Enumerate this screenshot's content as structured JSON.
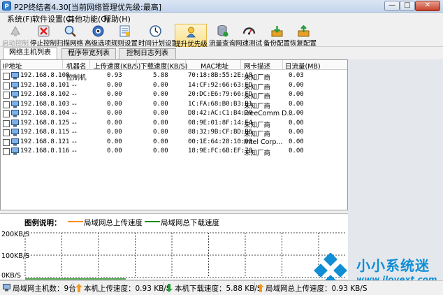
{
  "window": {
    "title": "P2P终结者4.30[当前网络管理优先级:最高]",
    "minimize": "—",
    "maximize": "□",
    "close": "✕"
  },
  "menu": [
    "系统(F)",
    "软件设置(C)",
    "其他功能(O)",
    "帮助(H)"
  ],
  "toolbar": [
    {
      "label": "启动控制",
      "icon": "start-control-icon",
      "enabled": false
    },
    {
      "label": "停止控制",
      "icon": "stop-control-icon",
      "enabled": true
    },
    {
      "label": "扫描网络",
      "icon": "scan-network-icon",
      "enabled": true
    },
    {
      "label": "高级选项",
      "icon": "advanced-options-icon",
      "enabled": true
    },
    {
      "label": "规则设置",
      "icon": "rule-settings-icon",
      "enabled": true
    },
    {
      "label": "时间计划设置",
      "icon": "time-plan-icon",
      "enabled": true
    },
    {
      "label": "提升优先级",
      "icon": "raise-priority-icon",
      "enabled": true,
      "active": true
    },
    {
      "label": "流量查询",
      "icon": "traffic-query-icon",
      "enabled": true
    },
    {
      "label": "网速测试",
      "icon": "speed-test-icon",
      "enabled": true
    },
    {
      "label": "备份配置",
      "icon": "backup-config-icon",
      "enabled": true
    },
    {
      "label": "恢复配置",
      "icon": "restore-config-icon",
      "enabled": true
    }
  ],
  "tabs": [
    {
      "label": "网络主机列表",
      "selected": true
    },
    {
      "label": "程序带宽列表",
      "selected": false
    },
    {
      "label": "控制日志列表",
      "selected": false
    }
  ],
  "table": {
    "columns": [
      "IP地址",
      "机器名",
      "上传速度(KB/S)",
      "下载速度(KB/S)",
      "MAC地址",
      "网卡描述",
      "日流量(MB)"
    ],
    "rows": [
      [
        "192.168.8.108",
        "控制机",
        "0.93",
        "5.88",
        "70:18:8B:55:2E:A8",
        "未知厂商",
        "0.03"
      ],
      [
        "192.168.8.101",
        "--",
        "0.00",
        "0.00",
        "14:CF:92:66:63:FD",
        "未知厂商",
        "0.00"
      ],
      [
        "192.168.8.102",
        "--",
        "0.00",
        "0.00",
        "20:DC:E6:79:66:FD",
        "未知厂商",
        "0.00"
      ],
      [
        "192.168.8.103",
        "--",
        "0.00",
        "0.00",
        "1C:FA:68:B0:B3:B1",
        "未知厂商",
        "0.00"
      ],
      [
        "192.168.8.104",
        "--",
        "0.00",
        "0.00",
        "D8:42:AC:C1:B4:28",
        "FreeComm D...",
        "0.00"
      ],
      [
        "192.168.8.125",
        "--",
        "0.00",
        "0.00",
        "08:9E:01:8F:14:F4",
        "未知厂商",
        "0.00"
      ],
      [
        "192.168.8.115",
        "--",
        "0.00",
        "0.00",
        "88:32:9B:CF:BD:B6",
        "未知厂商",
        "0.00"
      ],
      [
        "192.168.8.121",
        "--",
        "0.00",
        "0.00",
        "00:1E:64:28:10:00",
        "Intel Corp...",
        "0.00"
      ],
      [
        "192.168.8.116",
        "--",
        "0.00",
        "0.00",
        "18:9E:FC:6B:EF:78",
        "未知厂商",
        "0.00"
      ]
    ]
  },
  "legend": {
    "title": "图例说明：",
    "upload_label": "局域网总上传速度",
    "download_label": "局域网总下载速度",
    "upload_color": "#ff8c1a",
    "download_color": "#1a8c1a"
  },
  "chart": {
    "y_labels": [
      "200KB/S",
      "100KB/S",
      "0KB/S"
    ]
  },
  "watermark": {
    "name": "小小系统迷",
    "url": "www.ilovext.com"
  },
  "status": {
    "host_count": "局域网主机数：9台",
    "local_upload": "本机上传速度：0.93 KB/S",
    "local_download": "本机下载速度：5.88 KB/S",
    "lan_upload": "局域网总上传速度：0.93 KB/S"
  }
}
